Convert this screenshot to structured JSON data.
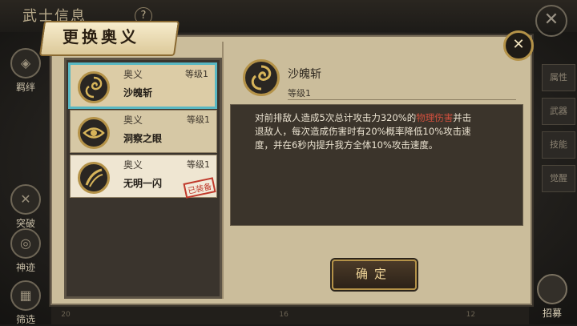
{
  "background": {
    "title": "武士信息",
    "help": "?",
    "close_glyph": "✕",
    "left_menu": [
      {
        "label": "羁绊",
        "icon": "bond-icon"
      },
      {
        "label": "突破",
        "icon": "breakthrough-icon"
      },
      {
        "label": "神迹",
        "icon": "miracle-icon"
      },
      {
        "label": "筛选",
        "icon": "filter-icon"
      }
    ],
    "right_tabs": [
      "属性",
      "武器",
      "技能",
      "觉醒"
    ],
    "bottom_numbers": [
      "20",
      "",
      "",
      "",
      "",
      "",
      "",
      "16",
      "",
      "",
      "",
      "",
      "",
      "12"
    ],
    "recruit_label": "招募"
  },
  "modal": {
    "title": "更换奥义",
    "close_glyph": "✕",
    "skills": [
      {
        "category": "奥义",
        "level": "等级1",
        "name": "沙魄斩",
        "selected": true,
        "equipped": false
      },
      {
        "category": "奥义",
        "level": "等级1",
        "name": "洞察之眼",
        "selected": false,
        "equipped": false
      },
      {
        "category": "奥义",
        "level": "等级1",
        "name": "无明一闪",
        "selected": false,
        "equipped": true
      }
    ],
    "equipped_stamp": "已装备",
    "detail": {
      "name": "沙魄斩",
      "level": "等级1",
      "desc_before": "对前排敌人造成5次总计攻击力320%的",
      "desc_highlight": "物理伤害",
      "desc_after": "并击退敌人，每次造成伤害时有20%概率降低10%攻击速度，并在6秒内提升我方全体10%攻击速度。"
    },
    "confirm_label": "确定"
  },
  "colors": {
    "selected_border": "#58b7c2",
    "highlight_text": "#d0503e",
    "gold": "#b49248"
  }
}
